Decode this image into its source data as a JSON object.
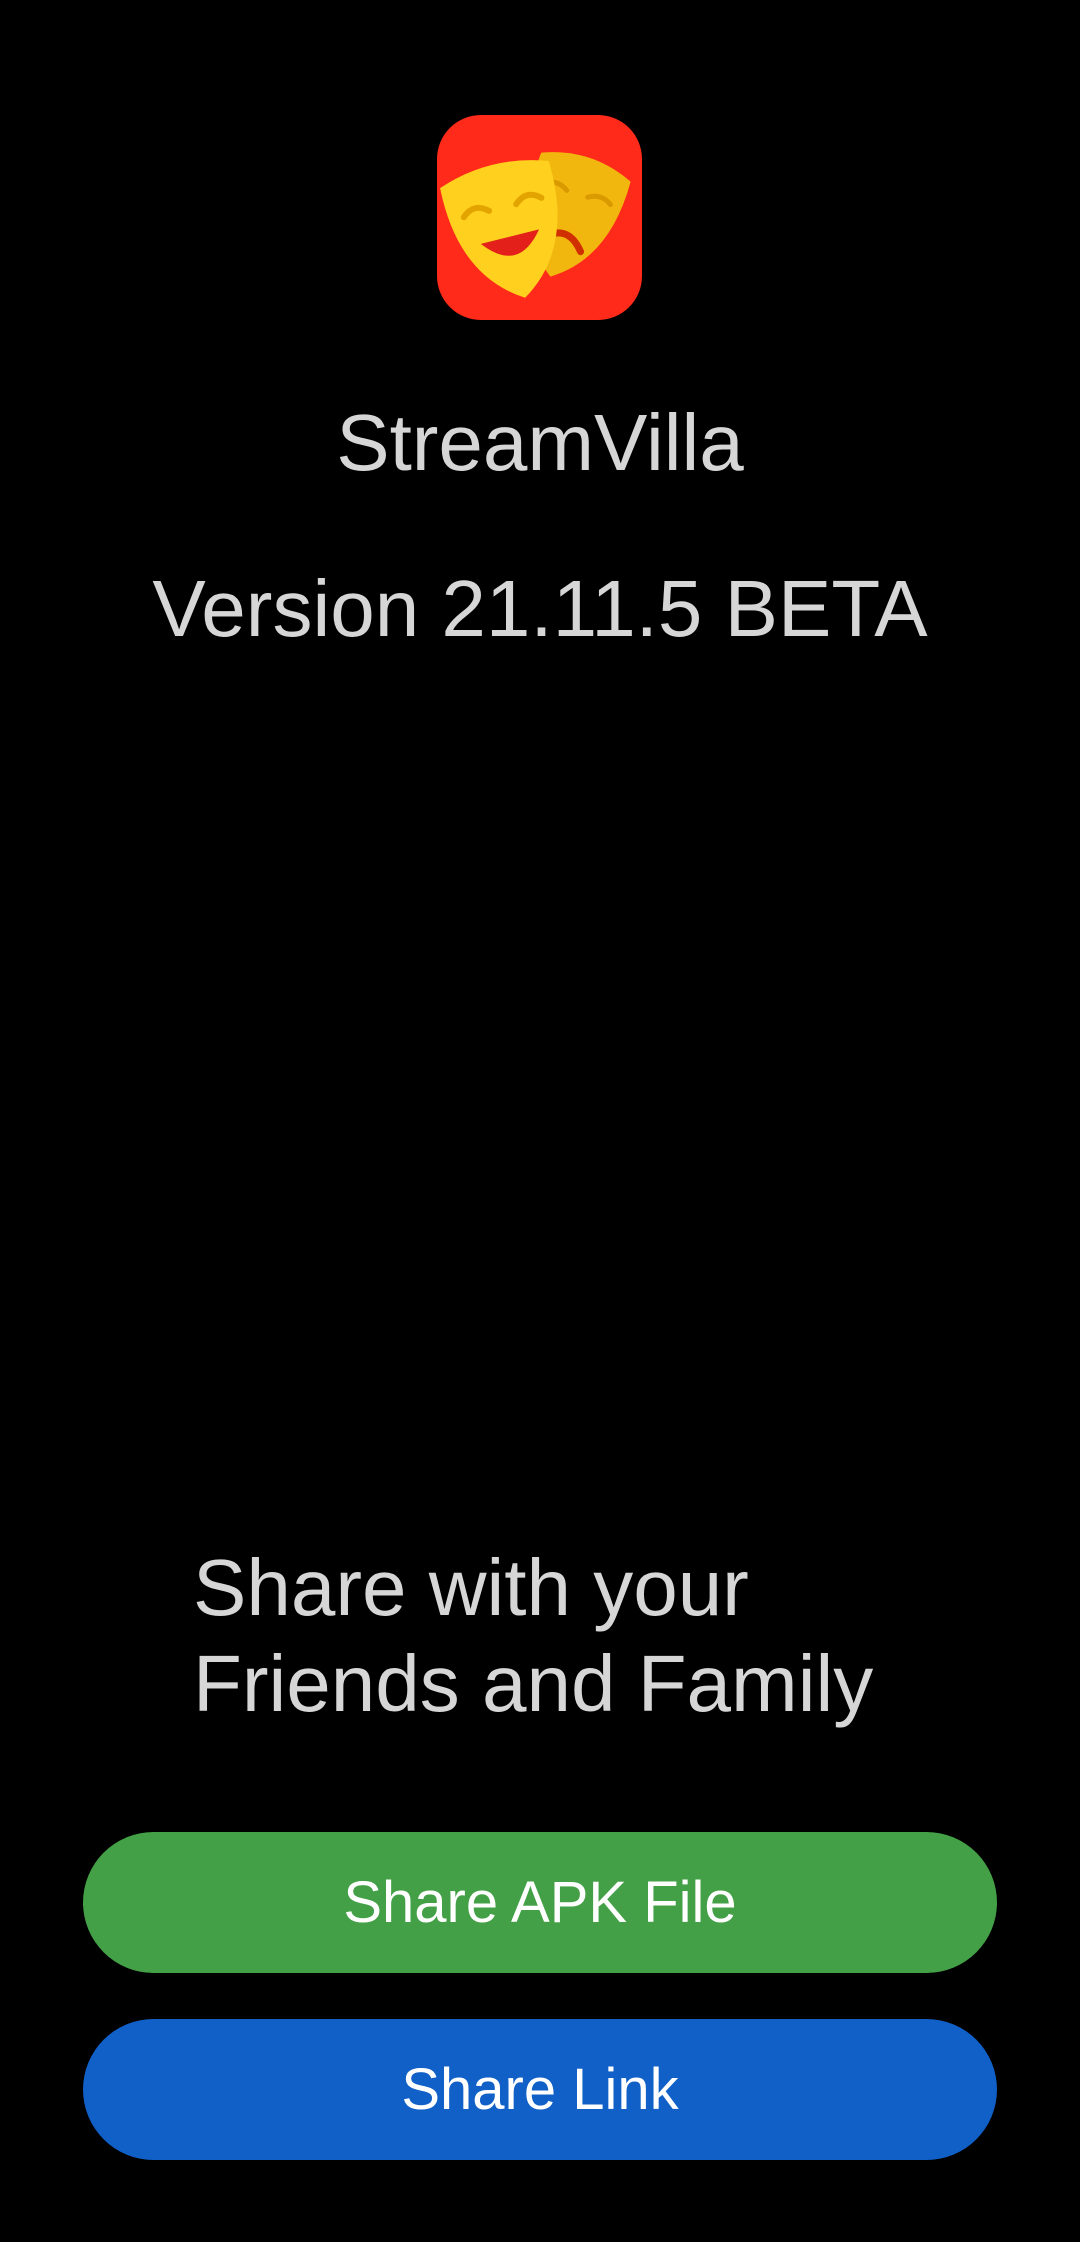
{
  "app": {
    "icon": "theater-masks-icon",
    "name": "StreamVilla",
    "version": "Version 21.11.5 BETA"
  },
  "share": {
    "heading_line1": "Share with your",
    "heading_line2": "Friends and Family",
    "apk_button_label": "Share APK File",
    "link_button_label": "Share Link"
  },
  "colors": {
    "background": "#000000",
    "text": "#d6d6d6",
    "icon_background": "#ff2a1a",
    "mask": "#ffc81e",
    "apk_button": "#43a047",
    "link_button": "#1060c8"
  }
}
